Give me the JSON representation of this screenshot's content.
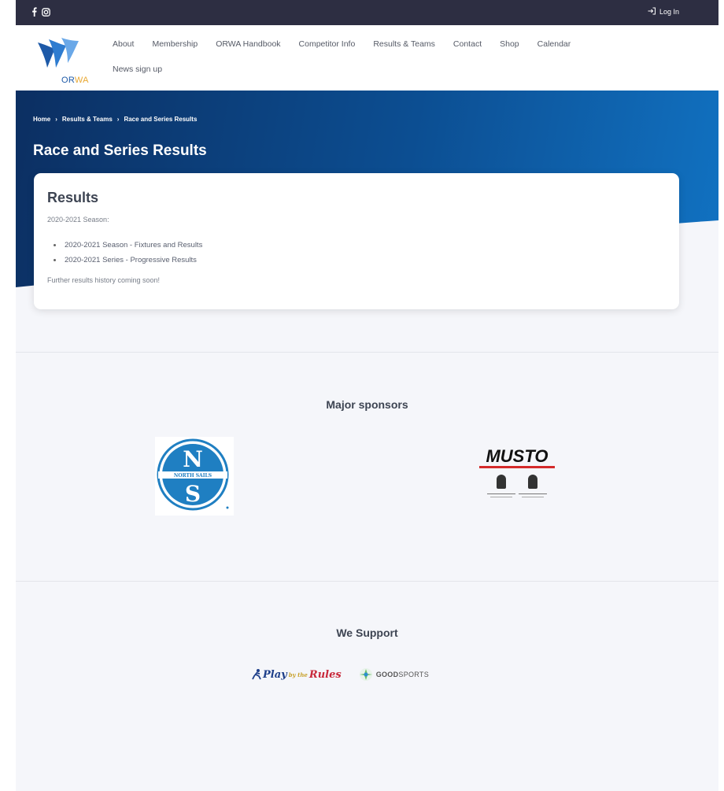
{
  "topbar": {
    "social": [
      {
        "icon": "facebook-icon"
      },
      {
        "icon": "instagram-icon"
      }
    ],
    "login_label": "Log In",
    "login_icon": "login-icon"
  },
  "header": {
    "logo_text_or": "OR",
    "logo_text_wa": "WA",
    "nav": [
      "About",
      "Membership",
      "ORWA Handbook",
      "Competitor Info",
      "Results & Teams",
      "Contact",
      "Shop",
      "Calendar",
      "News sign up"
    ]
  },
  "hero": {
    "breadcrumb": [
      "Home",
      "Results & Teams",
      "Race and Series Results"
    ],
    "title": "Race and Series Results"
  },
  "card": {
    "title": "Results",
    "season_label": "2020-2021 Season:",
    "links": [
      "2020-2021 Season - Fixtures and Results",
      "2020-2021 Series - Progressive Results"
    ],
    "footnote": "Further results history coming soon!"
  },
  "sponsors": {
    "heading": "Major sponsors",
    "north_sails": {
      "letter_top": "N",
      "band": "NORTH SAILS",
      "letter_bottom": "S"
    },
    "musto": {
      "name": "MUSTO"
    }
  },
  "support": {
    "heading": "We Support",
    "play_by_rules": {
      "play": "Play",
      "by": "by the",
      "rules": "Rules"
    },
    "goodsports": {
      "bold": "GOOD",
      "light": "SPORTS"
    }
  },
  "colors": {
    "topbar": "#2d2e42",
    "hero_dark": "#0c2f62",
    "hero_light": "#1172c2",
    "page_bg": "#f5f6fa",
    "brand_blue": "#1e5aa8",
    "brand_gold": "#e8a832"
  }
}
